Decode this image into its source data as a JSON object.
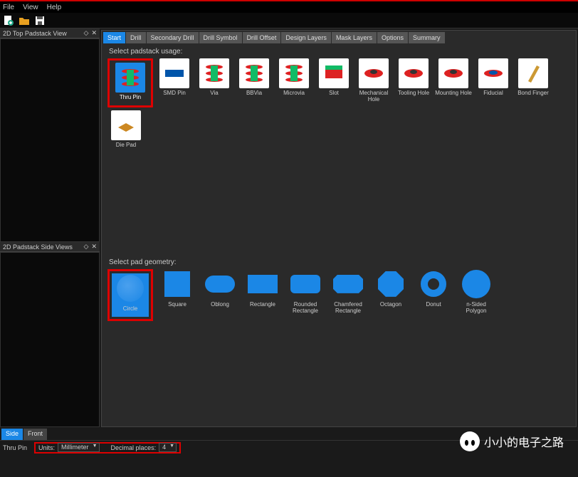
{
  "menu": {
    "file": "File",
    "view": "View",
    "help": "Help"
  },
  "panels": {
    "top": "2D Top Padstack View",
    "side": "2D Padstack Side Views"
  },
  "tabs": [
    "Start",
    "Drill",
    "Secondary Drill",
    "Drill Symbol",
    "Drill Offset",
    "Design Layers",
    "Mask Layers",
    "Options",
    "Summary"
  ],
  "active_tab": 0,
  "labels": {
    "usage": "Select padstack usage:",
    "geometry": "Select pad geometry:"
  },
  "usage_items": [
    {
      "label": "Thru Pin",
      "selected": true
    },
    {
      "label": "SMD Pin"
    },
    {
      "label": "Via"
    },
    {
      "label": "BBVia"
    },
    {
      "label": "Microvia"
    },
    {
      "label": "Slot"
    },
    {
      "label": "Mechanical Hole"
    },
    {
      "label": "Tooling Hole"
    },
    {
      "label": "Mounting Hole"
    },
    {
      "label": "Fiducial"
    },
    {
      "label": "Bond Finger"
    },
    {
      "label": "Die Pad"
    }
  ],
  "geometry_items": [
    {
      "label": "Circle",
      "selected": true
    },
    {
      "label": "Square"
    },
    {
      "label": "Oblong"
    },
    {
      "label": "Rectangle"
    },
    {
      "label": "Rounded Rectangle"
    },
    {
      "label": "Chamfered Rectangle"
    },
    {
      "label": "Octagon"
    },
    {
      "label": "Donut"
    },
    {
      "label": "n-Sided Polygon"
    }
  ],
  "bottom_tabs": [
    "Side",
    "Front"
  ],
  "active_bottom_tab": 0,
  "status": {
    "type": "Thru Pin",
    "units_label": "Units:",
    "units_value": "Millimeter",
    "decimal_label": "Decimal places:",
    "decimal_value": "4"
  },
  "watermark": "小小的电子之路",
  "colors": {
    "accent": "#1b87e6",
    "highlight": "#d00"
  }
}
